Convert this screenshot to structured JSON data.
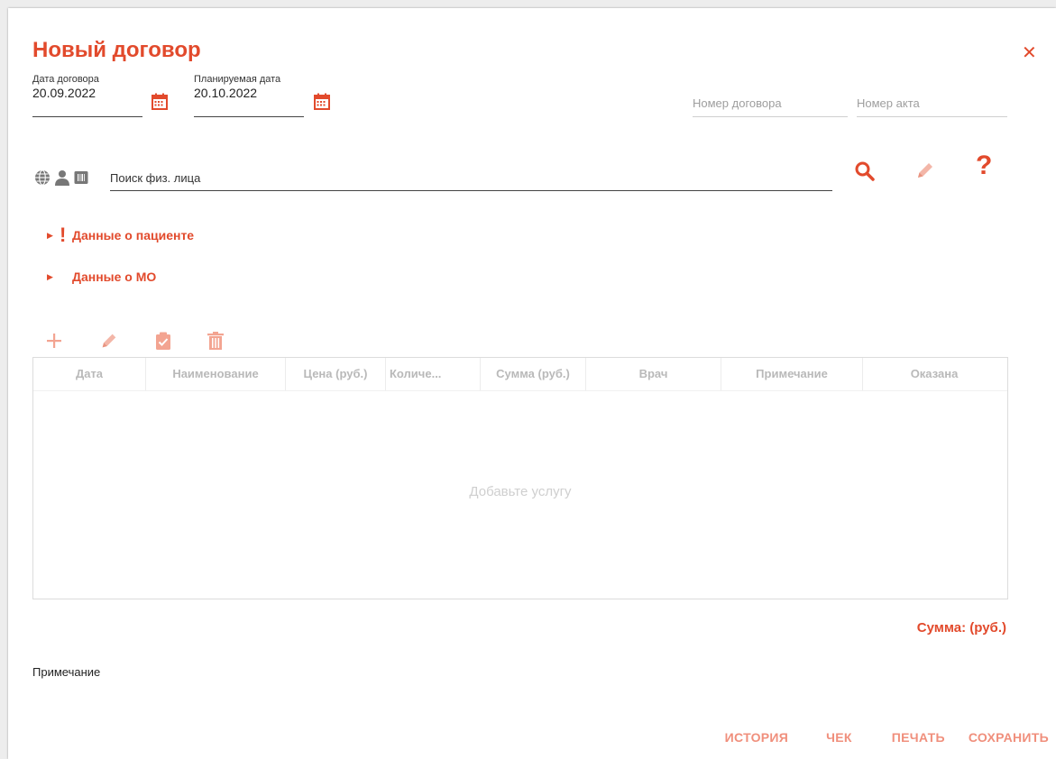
{
  "dialog": {
    "title": "Новый договор",
    "close_label": "✕"
  },
  "dates": {
    "contract_date_label": "Дата договора",
    "contract_date_value": "20.09.2022",
    "planned_date_label": "Планируемая дата",
    "planned_date_value": "20.10.2022"
  },
  "fields": {
    "contract_number_placeholder": "Номер договора",
    "act_number_placeholder": "Номер акта"
  },
  "search": {
    "placeholder": "Поиск физ. лица",
    "icons": [
      "globe-icon",
      "person-icon",
      "card-icon"
    ],
    "action_icons": [
      "search-icon",
      "pencil-icon",
      "question-icon"
    ]
  },
  "sections": {
    "patient_label": "Данные о пациенте",
    "mo_label": "Данные о МО"
  },
  "grid": {
    "toolbar_icons": [
      "plus-icon",
      "pencil-icon",
      "clipboard-check-icon",
      "trash-icon"
    ],
    "columns": [
      "Дата",
      "Наименование",
      "Цена (руб.)",
      "Количе...",
      "Сумма (руб.)",
      "Врач",
      "Примечание",
      "Оказана"
    ],
    "empty_text": "Добавьте услугу"
  },
  "sum_label": "Сумма:  (руб.)",
  "note_label": "Примечание",
  "footer": {
    "history": "ИСТОРИЯ",
    "check": "ЧЕК",
    "print": "ПЕЧАТЬ",
    "save": "СОХРАНИТЬ"
  },
  "colors": {
    "accent": "#e24a2c",
    "accent_light": "#f08f7c",
    "muted": "#b9b9b9"
  }
}
